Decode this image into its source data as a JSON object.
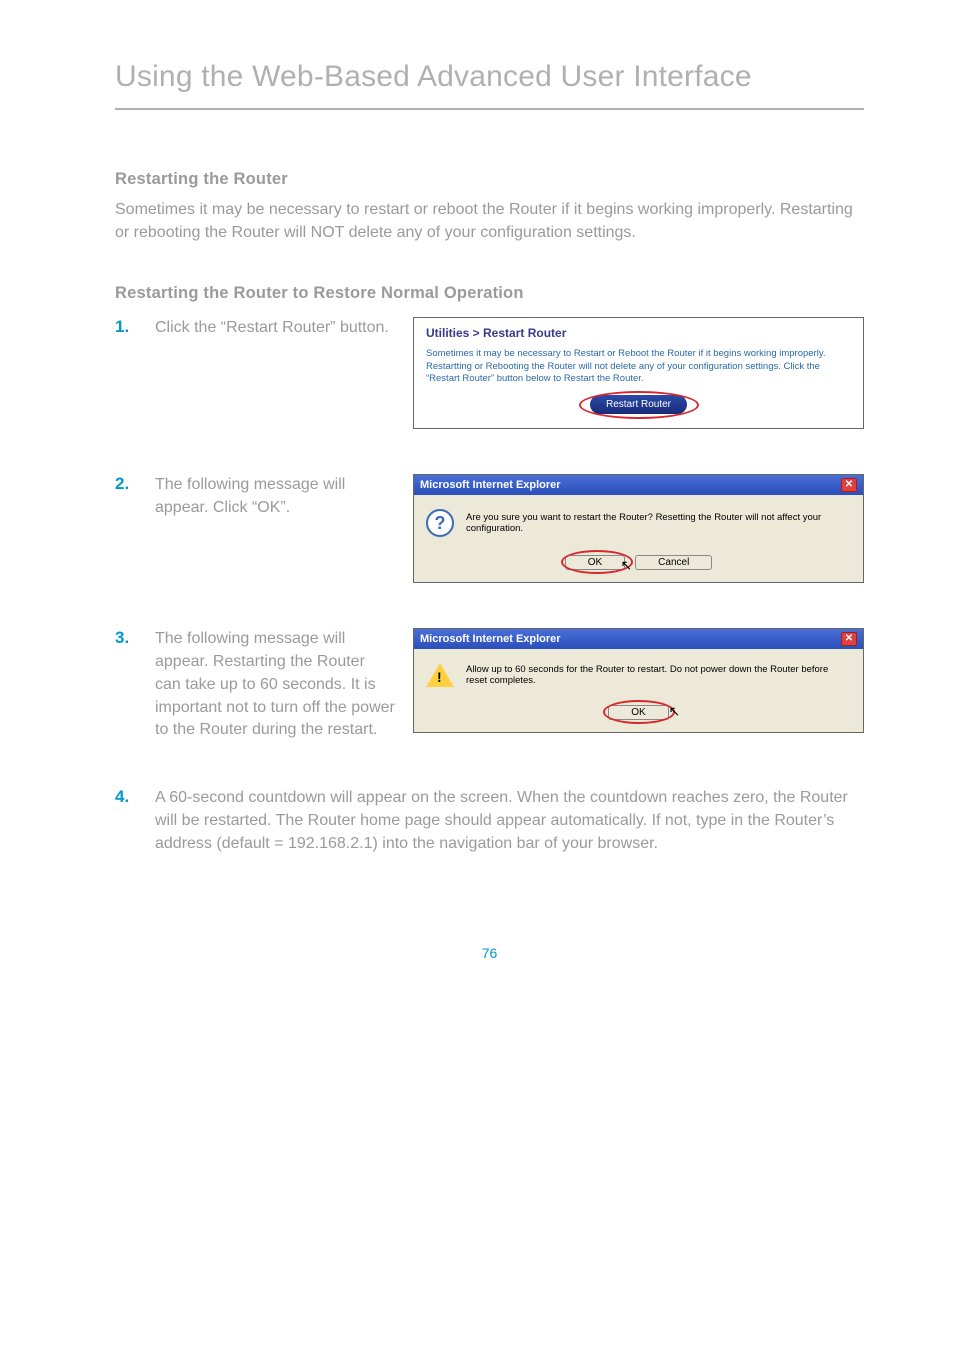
{
  "banner": "Using the Web-Based Advanced User Interface",
  "section1_title": "Restarting the Router",
  "section1_body": "Sometimes it may be necessary to restart or reboot the Router if it begins working improperly. Restarting or rebooting the Router will NOT delete any of your configuration settings.",
  "section2_title": "Restarting the Router to Restore Normal Operation",
  "steps": {
    "s1": {
      "num": "1.",
      "text": "Click the “Restart Router” button."
    },
    "s2": {
      "num": "2.",
      "text": "The following message will appear. Click “OK”."
    },
    "s3": {
      "num": "3.",
      "text": "The following message will appear. Restarting the Router can take up to 60 seconds. It is important not to turn off the power to the Router during the restart."
    },
    "s4": {
      "num": "4.",
      "text": "A 60-second countdown will appear on the screen. When the countdown reaches zero, the Router will be restarted. The Router home page should appear automatically. If not, type in the Router’s address (default = 192.168.2.1) into the navigation bar of your browser."
    }
  },
  "shot1": {
    "title": "Utilities > Restart Router",
    "body": "Sometimes it may be necessary to Restart or Reboot the Router if it begins working improperly. Restartting or Rebooting the Router will not delete any of your configuration settings. Click the “Restart Router” button below to Restart the Router.",
    "button": "Restart Router"
  },
  "ie": {
    "title": "Microsoft Internet Explorer",
    "msg_confirm": "Are you sure you want to restart the Router? Resetting the Router will not affect your configuration.",
    "msg_wait": "Allow up to 60 seconds for the Router to restart. Do not power down the Router before reset completes.",
    "ok": "OK",
    "cancel": "Cancel"
  },
  "pagenum": "76"
}
